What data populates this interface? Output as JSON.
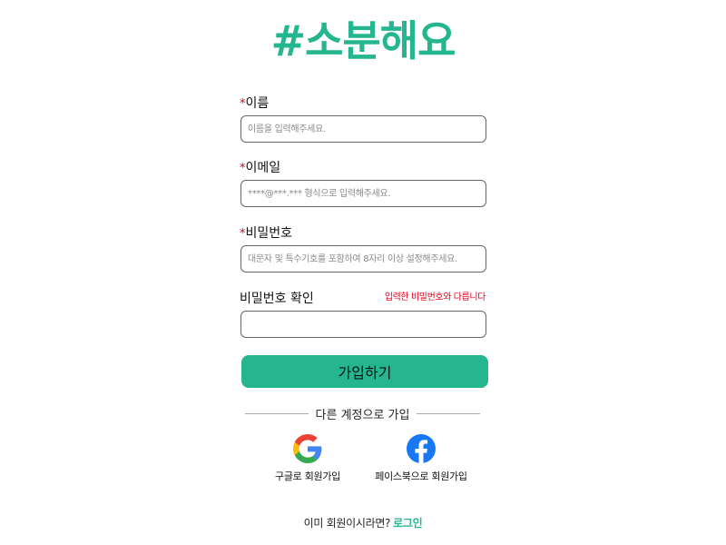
{
  "brand": {
    "logo_text": "#소분해요",
    "accent_color": "#26b68f",
    "required_color": "#e0001b"
  },
  "form": {
    "required_mark": "*",
    "name": {
      "label": "이름",
      "placeholder": "이름을 입력해주세요.",
      "value": ""
    },
    "email": {
      "label": "이메일",
      "placeholder": "****@***.*** 형식으로 입력해주세요.",
      "value": ""
    },
    "password": {
      "label": "비밀번호",
      "placeholder": "대문자 및 특수기호를 포함하여 8자리 이상 설정해주세요.",
      "value": ""
    },
    "password_confirm": {
      "label": "비밀번호 확인",
      "error": "입력한 비밀번호와 다릅니다",
      "value": ""
    },
    "submit_label": "가입하기"
  },
  "social": {
    "divider_text": "다른 계정으로 가입",
    "google": {
      "icon": "google-icon",
      "label": "구글로 회원가입"
    },
    "facebook": {
      "icon": "facebook-icon",
      "label": "페이스북으로 회원가입",
      "color": "#1877f2"
    }
  },
  "footer": {
    "prompt": "이미 회원이시라면?",
    "login_link": "로그인"
  }
}
